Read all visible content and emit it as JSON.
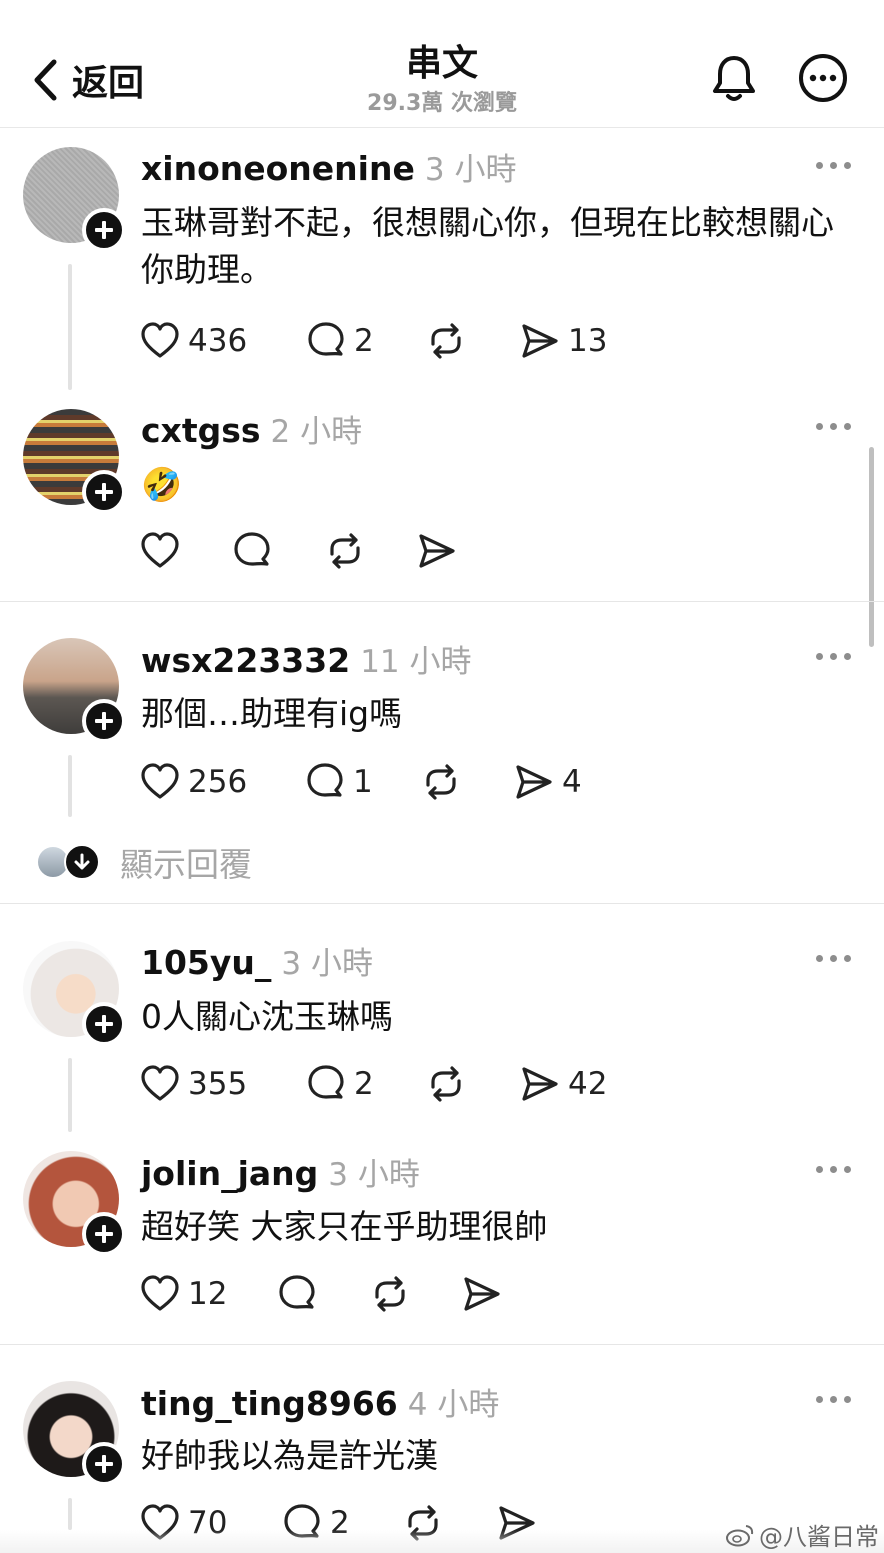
{
  "header": {
    "back_label": "返回",
    "title": "串文",
    "subtitle": "29.3萬 次瀏覽"
  },
  "posts": [
    {
      "username": "xinoneonenine",
      "time": "3 小時",
      "text": "玉琳哥對不起，很想關心你，但現在比較想關心你助理。",
      "likes": "436",
      "replies": "2",
      "shares": "13"
    },
    {
      "username": "cxtgss",
      "time": "2 小時",
      "text": "🤣",
      "likes": "",
      "replies": "",
      "shares": ""
    },
    {
      "username": "wsx223332",
      "time": "11 小時",
      "text": "那個…助理有ig嗎",
      "likes": "256",
      "replies": "1",
      "shares": "4"
    },
    {
      "username": "105yu_",
      "time": "3 小時",
      "text": "0人關心沈玉琳嗎",
      "likes": "355",
      "replies": "2",
      "shares": "42"
    },
    {
      "username": "jolin_jang",
      "time": "3 小時",
      "text": "超好笑 大家只在乎助理很帥",
      "likes": "12",
      "replies": "",
      "shares": ""
    },
    {
      "username": "ting_ting8966",
      "time": "4 小時",
      "text": "好帥我以為是許光漢",
      "likes": "70",
      "replies": "2",
      "shares": ""
    }
  ],
  "show_replies_label": "顯示回覆",
  "watermark": "@八酱日常",
  "icons": {
    "back": "chevron-left-icon",
    "bell": "bell-icon",
    "more": "more-circle-icon",
    "like": "heart-icon",
    "reply": "comment-icon",
    "repost": "repost-icon",
    "share": "send-icon"
  }
}
